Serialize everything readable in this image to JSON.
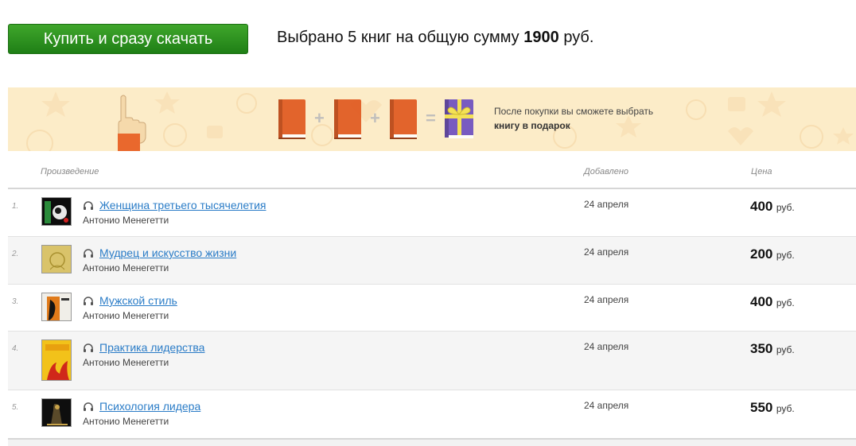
{
  "header": {
    "buy_button_label": "Купить и сразу скачать",
    "summary_prefix": "Выбрано 5 книг на общую сумму",
    "summary_total": "1900",
    "summary_currency": "руб."
  },
  "promo": {
    "line1": "После покупки вы сможете выбрать",
    "line2": "книгу в подарок",
    "plus_sign": "+",
    "equals_sign": "="
  },
  "table": {
    "columns": [
      "Произведение",
      "Добавлено",
      "Цена"
    ],
    "rows": [
      {
        "num": "1.",
        "title": "Женщина третьего тысячелетия",
        "author": "Антонио Менегетти",
        "date": "24 апреля",
        "price": "400",
        "currency": "руб."
      },
      {
        "num": "2.",
        "title": "Мудрец и искусство жизни",
        "author": "Антонио Менегетти",
        "date": "24 апреля",
        "price": "200",
        "currency": "руб."
      },
      {
        "num": "3.",
        "title": "Мужской стиль",
        "author": "Антонио Менегетти",
        "date": "24 апреля",
        "price": "400",
        "currency": "руб."
      },
      {
        "num": "4.",
        "title": "Практика лидерства",
        "author": "Антонио Менегетти",
        "date": "24 апреля",
        "price": "350",
        "currency": "руб."
      },
      {
        "num": "5.",
        "title": "Психология лидера",
        "author": "Антонио Менегетти",
        "date": "24 апреля",
        "price": "550",
        "currency": "руб."
      }
    ]
  },
  "icons": {
    "headphones": "headphones-icon",
    "book": "book-icon",
    "gift": "gift-book-icon",
    "hand": "pointing-hand-icon"
  },
  "colors": {
    "buy_button": "#2f9a22",
    "promo_bg": "#fcecc8",
    "link": "#2a7cc7",
    "book_orange": "#e0561c",
    "gift_purple": "#6a4cc0",
    "ribbon": "#f4e04a"
  }
}
